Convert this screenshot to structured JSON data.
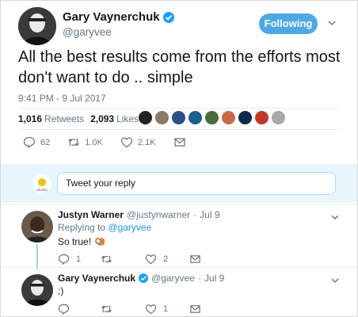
{
  "tweet": {
    "author_name": "Gary Vaynerchuk",
    "author_handle": "@garyvee",
    "follow_label": "Following",
    "text": "All the best results come from the efforts most don't want to do .. simple",
    "timestamp": "9:41 PM - 9 Jul 2017",
    "retweets_count": "1,016",
    "retweets_label": "Retweets",
    "likes_count": "2,093",
    "likes_label": "Likes",
    "actions": {
      "replies": "62",
      "retweets": "1.0K",
      "likes": "2.1K"
    }
  },
  "reply_box": {
    "placeholder": "Tweet your reply",
    "avatar_text": "drunity"
  },
  "replies": [
    {
      "name": "Justyn Warner",
      "handle": "@justynwarner",
      "separator": "·",
      "date": "Jul 9",
      "replying_prefix": "Replying to",
      "replying_to": "@garyvee",
      "text": "So true!",
      "replies": "1",
      "retweets": "",
      "likes": "2"
    },
    {
      "name": "Gary Vaynerchuk",
      "handle": "@garyvee",
      "separator": "·",
      "date": "Jul 9",
      "text": ";)",
      "replies": "",
      "retweets": "",
      "likes": "1"
    }
  ],
  "colors": {
    "accent": "#1da1f2",
    "follow_bg": "#4ea8e6",
    "reply_bg": "#e8f5fd",
    "thread_line": "#9ad0f1",
    "muted": "#657786"
  }
}
